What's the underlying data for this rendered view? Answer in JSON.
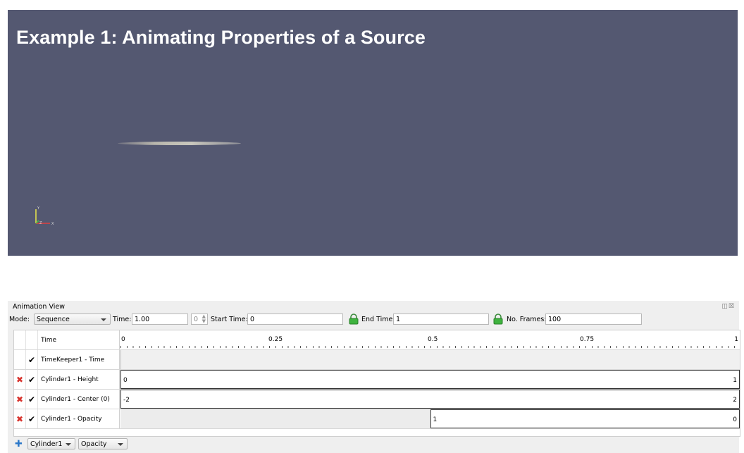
{
  "slide": {
    "title": "Example 1: Animating Properties of a Source"
  },
  "viewport": {
    "background": "#545871",
    "axes_labels": [
      "Y",
      "Z",
      "X"
    ]
  },
  "animation_view": {
    "title": "Animation View",
    "mode_label": "Mode:",
    "mode_value": "Sequence",
    "time_label": "Time:",
    "time_value": "1.00",
    "time_index": "0",
    "start_time_label": "Start Time:",
    "start_time_value": "0",
    "end_time_label": "End Time:",
    "end_time_value": "1",
    "frames_label": "No. Frames:",
    "frames_value": "100",
    "lock_color": "#3fb33f"
  },
  "timeline": {
    "header": "Time",
    "ruler": [
      "0",
      "0.25",
      "0.5",
      "0.75",
      "1"
    ],
    "tracks": [
      {
        "name": "TimeKeeper1 - Time",
        "deletable": false,
        "checked": true
      },
      {
        "name": "Cylinder1 - Height",
        "deletable": true,
        "checked": true,
        "start_value": "0",
        "end_value": "1"
      },
      {
        "name": "Cylinder1 - Center (0)",
        "deletable": true,
        "checked": true,
        "start_value": "-2",
        "end_value": "2"
      },
      {
        "name": "Cylinder1 - Opacity",
        "deletable": true,
        "checked": true,
        "mid_value": "1",
        "end_value": "0",
        "keyframe_start": 0.5
      }
    ]
  },
  "add_track": {
    "source": "Cylinder1",
    "property": "Opacity"
  },
  "glyphs": {
    "delete": "✖",
    "check": "✔",
    "plus": "✚"
  }
}
